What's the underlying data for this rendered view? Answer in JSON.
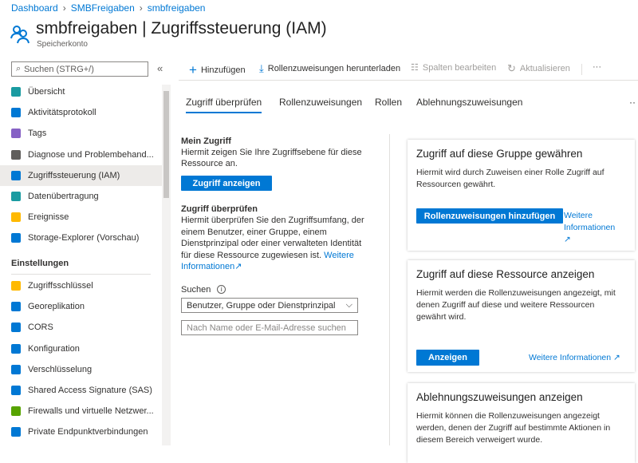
{
  "breadcrumb": [
    "Dashboard",
    "SMBFreigaben",
    "smbfreigaben"
  ],
  "header": {
    "title": "smbfreigaben | Zugriffssteuerung (IAM)",
    "subtitle": "Speicherkonto"
  },
  "sidebar": {
    "search_placeholder": "Suchen (STRG+/)",
    "collapse": "«",
    "items": [
      {
        "label": "Übersicht",
        "color": "#1a9ba1"
      },
      {
        "label": "Aktivitätsprotokoll",
        "color": "#0078d4"
      },
      {
        "label": "Tags",
        "color": "#8661c5"
      },
      {
        "label": "Diagnose und Problembehand...",
        "color": "#605e5c"
      },
      {
        "label": "Zugriffssteuerung (IAM)",
        "color": "#0078d4"
      },
      {
        "label": "Datenübertragung",
        "color": "#1a9ba1"
      },
      {
        "label": "Ereignisse",
        "color": "#ffb900"
      },
      {
        "label": "Storage-Explorer (Vorschau)",
        "color": "#0078d4"
      }
    ],
    "section": "Einstellungen",
    "settings": [
      {
        "label": "Zugriffsschlüssel",
        "color": "#ffb900"
      },
      {
        "label": "Georeplikation",
        "color": "#0078d4"
      },
      {
        "label": "CORS",
        "color": "#0078d4"
      },
      {
        "label": "Konfiguration",
        "color": "#0078d4"
      },
      {
        "label": "Verschlüsselung",
        "color": "#0078d4"
      },
      {
        "label": "Shared Access Signature (SAS)",
        "color": "#0078d4"
      },
      {
        "label": "Firewalls und virtuelle Netzwer...",
        "color": "#57a300"
      },
      {
        "label": "Private Endpunktverbindungen",
        "color": "#0078d4"
      }
    ]
  },
  "toolbar": {
    "add": "Hinzufügen",
    "download": "Rollenzuweisungen herunterladen",
    "columns": "Spalten bearbeiten",
    "refresh": "Aktualisieren",
    "more": "···"
  },
  "tabs": [
    "Zugriff überprüfen",
    "Rollenzuweisungen",
    "Rollen",
    "Ablehnungszuweisungen"
  ],
  "tabs_more": "··",
  "my_access": {
    "title": "Mein Zugriff",
    "text": "Hiermit zeigen Sie Ihre Zugriffsebene für diese Ressource an.",
    "button": "Zugriff anzeigen"
  },
  "check_access": {
    "title": "Zugriff überprüfen",
    "text": "Hiermit überprüfen Sie den Zugriffsumfang, der einem Benutzer, einer Gruppe, einem Dienstprinzipal oder einer verwalteten Identität für diese Ressource zugewiesen ist.",
    "link": "Weitere Informationen",
    "search_label": "Suchen",
    "select_value": "Benutzer, Gruppe oder Dienstprinzipal",
    "input_placeholder": "Nach Name oder E-Mail-Adresse suchen"
  },
  "cards": [
    {
      "title": "Zugriff auf diese Gruppe gewähren",
      "text": "Hiermit wird durch Zuweisen einer Rolle Zugriff auf Ressourcen gewährt.",
      "button": "Rollenzuweisungen hinzufügen",
      "link": "Weitere Informationen"
    },
    {
      "title": "Zugriff auf diese Ressource anzeigen",
      "text": "Hiermit werden die Rollenzuweisungen angezeigt, mit denen Zugriff auf diese und weitere Ressourcen gewährt wird.",
      "button": "Anzeigen",
      "link": "Weitere Informationen"
    },
    {
      "title": "Ablehnungszuweisungen anzeigen",
      "text": "Hiermit können die Rollenzuweisungen angezeigt werden, denen der Zugriff auf bestimmte Aktionen in diesem Bereich verweigert wurde."
    }
  ]
}
